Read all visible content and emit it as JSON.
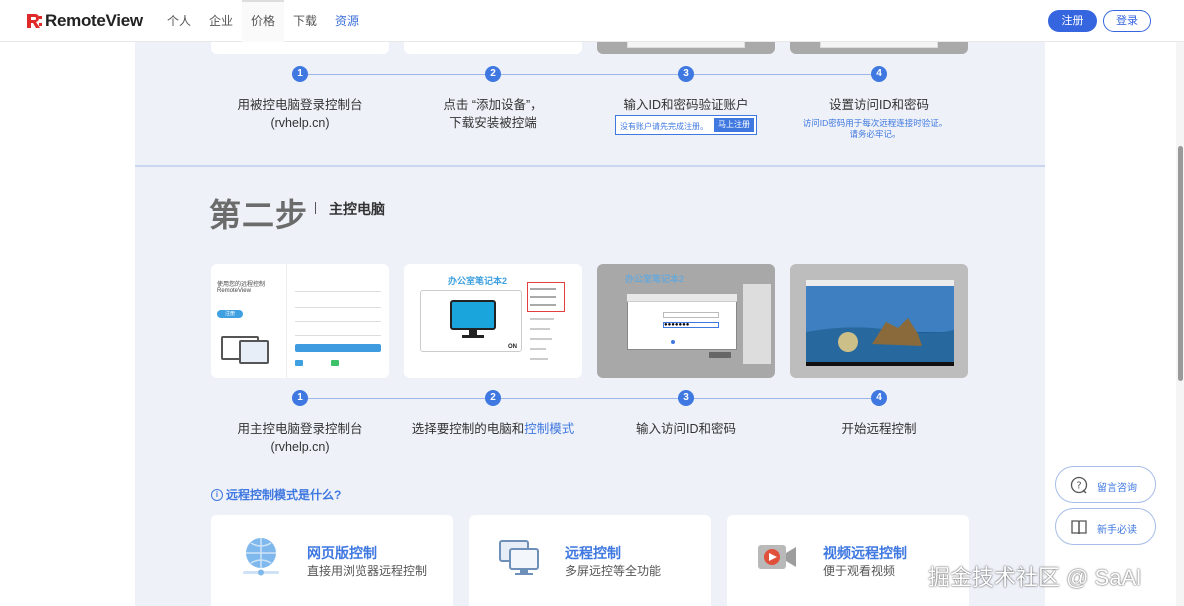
{
  "nav": {
    "logo_text": "RemoteView",
    "links": [
      "个人",
      "企业",
      "价格",
      "下载",
      "资源"
    ],
    "register": "注册",
    "login": "登录"
  },
  "section1": {
    "steps": [
      {
        "num": "1",
        "line1": "用被控电脑登录控制台",
        "line2": "(rvhelp.cn)"
      },
      {
        "num": "2",
        "line1": "点击 “添加设备”，",
        "line2": "下载安装被控端"
      },
      {
        "num": "3",
        "line1": "输入ID和密码验证账户",
        "line2": ""
      },
      {
        "num": "4",
        "line1": "设置访问ID和密码",
        "line2": ""
      }
    ],
    "hint_box_text": "没有账户请先完成注册。",
    "hint_box_button": "马上注册",
    "hint_text_line1": "访问ID密码用于每次远程连接时验证。",
    "hint_text_line2": "请务必牢记。"
  },
  "section2": {
    "title": "第二步",
    "subtitle": "主控电脑",
    "steps": [
      {
        "num": "1",
        "line1": "用主控电脑登录控制台",
        "line2": "(rvhelp.cn)"
      },
      {
        "num": "2",
        "line1_pre": "选择要控制的电脑和",
        "line1_hl": "控制模式",
        "line2": ""
      },
      {
        "num": "3",
        "line1": "输入访问ID和密码",
        "line2": ""
      },
      {
        "num": "4",
        "line1": "开始远程控制",
        "line2": ""
      }
    ],
    "shot1": {
      "title": "使用您的远程控制",
      "brand": "RemoteView",
      "btn": "注册"
    },
    "shot2": {
      "title": "办公室笔记本2",
      "on_label": "ON"
    },
    "shot3": {
      "title": "办公室笔记本2"
    }
  },
  "modes": {
    "heading": "远程控制模式是什么?",
    "info_icon": "i",
    "cards": [
      {
        "title": "网页版控制",
        "desc": "直接用浏览器远程控制"
      },
      {
        "title": "远程控制",
        "desc": "多屏远控等全功能"
      },
      {
        "title": "视频远程控制",
        "desc": "便于观看视频"
      }
    ]
  },
  "float": {
    "consult": "留言咨询",
    "guide": "新手必读"
  },
  "watermark": "掘金技术社区 @ SaAl",
  "colors": {
    "accent": "#3f78e0",
    "brand_red": "#e02a2a",
    "page_bg": "#eef1f8"
  }
}
